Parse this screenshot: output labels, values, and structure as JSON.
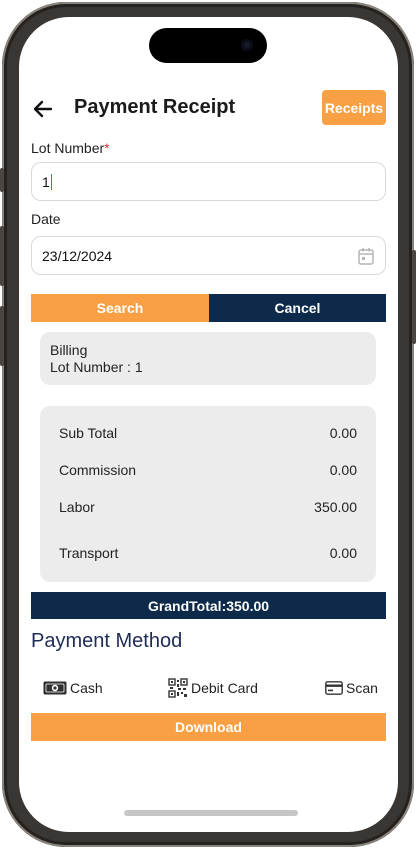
{
  "header": {
    "title": "Payment Receipt",
    "receipts_label": "Receipts"
  },
  "form": {
    "lot_label": "Lot Number",
    "lot_required_mark": "*",
    "lot_value": "1",
    "date_label": "Date",
    "date_value": "23/12/2024"
  },
  "actions": {
    "search_label": "Search",
    "cancel_label": "Cancel"
  },
  "billing": {
    "title": "Billing",
    "lot_line": "Lot Number : 1"
  },
  "totals": [
    {
      "label": "Sub Total",
      "value": "0.00"
    },
    {
      "label": "Commission",
      "value": "0.00"
    },
    {
      "label": "Labor",
      "value": "350.00"
    },
    {
      "label": "Transport",
      "value": "0.00"
    }
  ],
  "grand_total": "GrandTotal:350.00",
  "payment": {
    "title": "Payment Method",
    "options": [
      {
        "label": "Cash",
        "icon": "cash-icon"
      },
      {
        "label": "Debit Card",
        "icon": "qr-code-icon"
      },
      {
        "label": "Scan",
        "icon": "card-icon"
      }
    ]
  },
  "download_label": "Download",
  "colors": {
    "accent": "#f8a043",
    "navy": "#0d2a4a",
    "title_blue": "#1d2b55"
  }
}
